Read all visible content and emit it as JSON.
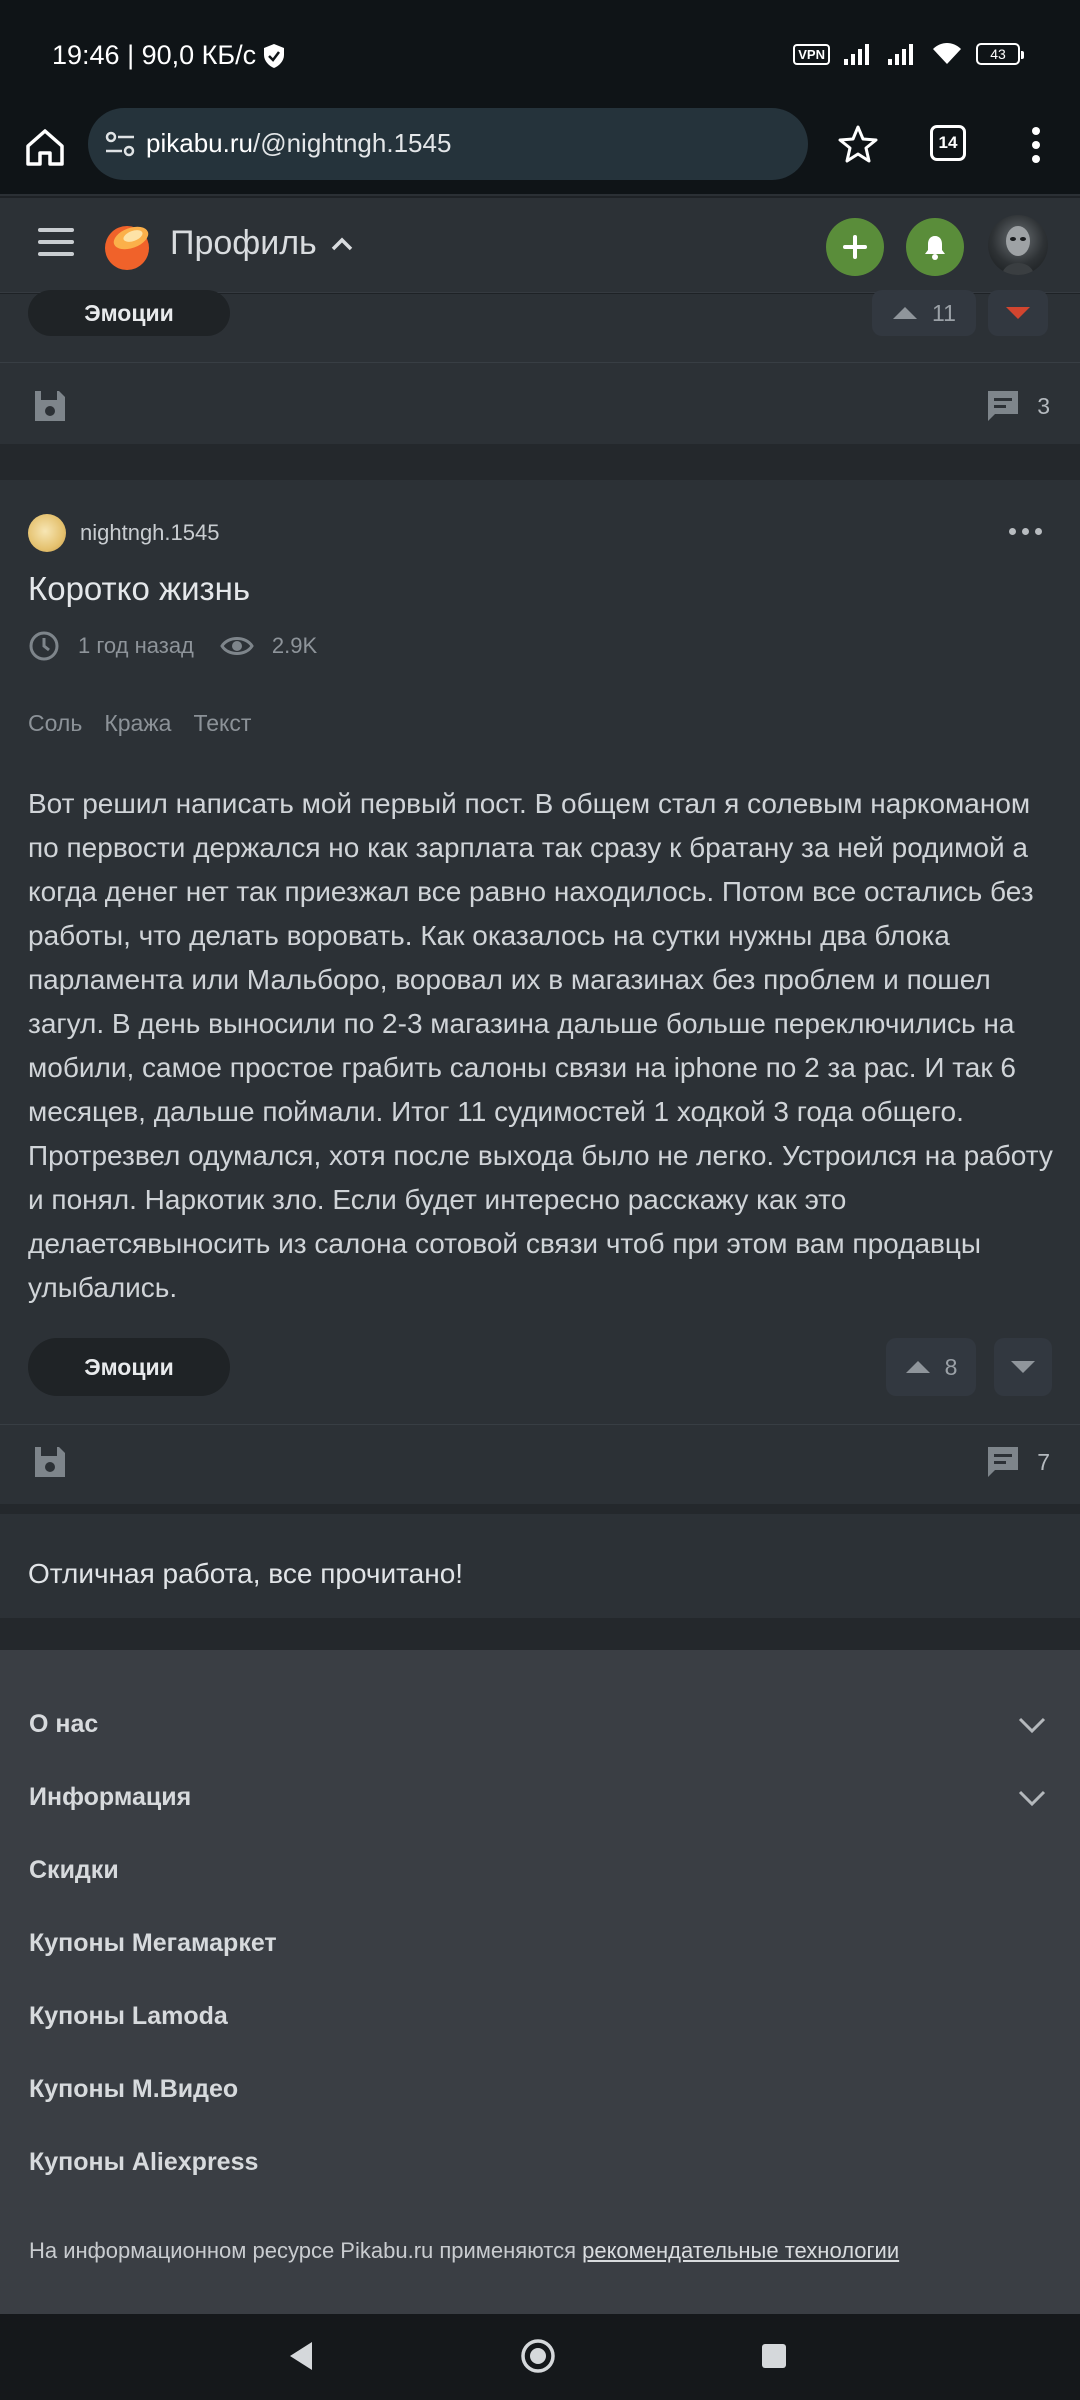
{
  "status_bar": {
    "time_speed": "19:46 | 90,0 КБ/с",
    "vpn": "VPN",
    "battery": "43"
  },
  "browser": {
    "url_host": "pikabu.ru",
    "url_path": "/@nightngh.1545",
    "tab_count": "14"
  },
  "header": {
    "title": "Профиль"
  },
  "prev_post": {
    "reaction_label": "Эмоции",
    "upvotes": "11",
    "comments": "3"
  },
  "post": {
    "author": "nightngh.1545",
    "title": "Коротко жизнь",
    "time": "1 год назад",
    "views": "2.9K",
    "tags": [
      "Соль",
      "Кража",
      "Текст"
    ],
    "body": "Вот решил написать мой первый пост. В общем стал я солевым наркоманом по первости держался но как зарплата так сразу к братану за ней родимой а когда денег нет так приезжал все равно находилось. Потом все остались без работы, что делать воровать. Как оказалось на сутки нужны два блока парламента или Мальборо, воровал их в магазинах без проблем и пошел загул. В день выносили по 2-3 магазина дальше больше переключились на мобили, самое простое грабить салоны связи на iphone по 2 за рас. И так 6 месяцев, дальше поймали. Итог 11 судимостей 1 ходкой 3 года общего. Протрезвел одумался, хотя после выхода было не легко. Устроился на работу и понял. Наркотик зло. Если будет интересно расскажу как это делаетсявыносить из салона сотовой связи чтоб при этом вам продавцы улыбались.",
    "reaction_label": "Эмоции",
    "upvotes": "8",
    "comments": "7"
  },
  "done_message": "Отличная работа, все прочитано!",
  "footer": {
    "items": [
      {
        "label": "О нас",
        "expandable": true
      },
      {
        "label": "Информация",
        "expandable": true
      },
      {
        "label": "Скидки",
        "expandable": false
      },
      {
        "label": "Купоны Мегамаркет",
        "expandable": false
      },
      {
        "label": "Купоны Lamoda",
        "expandable": false
      },
      {
        "label": "Купоны М.Видео",
        "expandable": false
      },
      {
        "label": "Купоны Aliexpress",
        "expandable": false
      }
    ],
    "note_prefix": "На информационном ресурсе Pikabu.ru применяются ",
    "note_link": "рекомендательные технологии"
  },
  "colors": {
    "accent_green": "#5a8d3a",
    "downvote_red": "#d2452f",
    "logo_orange": "#f0622a"
  }
}
